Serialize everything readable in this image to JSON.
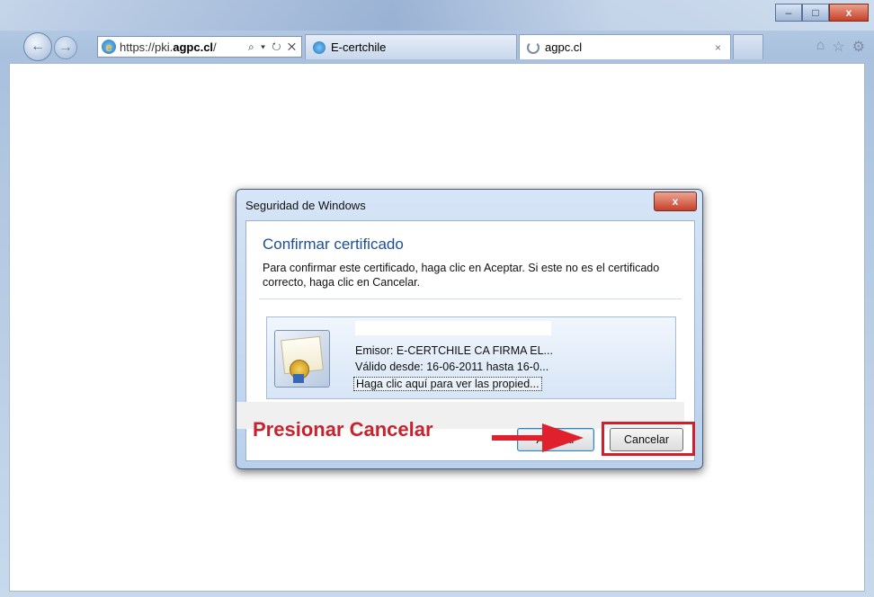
{
  "browser": {
    "address_url_prefix": "https://pki.",
    "address_url_domain": "agpc.cl",
    "address_url_suffix": "/",
    "address_tools": "⌕ ▾ ↻ ✕",
    "tabs": [
      {
        "label": "E-certchile",
        "close": ""
      },
      {
        "label": "agpc.cl",
        "close": "×"
      }
    ],
    "window_controls": {
      "minimize": "–",
      "maximize": "□",
      "close": "x"
    },
    "right_icons": {
      "home": "⌂",
      "favorites": "☆",
      "settings": "⚙"
    }
  },
  "dialog": {
    "title": "Seguridad de Windows",
    "close": "x",
    "heading": "Confirmar certificado",
    "message": "Para confirmar este certificado, haga clic en Aceptar. Si este no es el certificado correcto, haga clic en Cancelar.",
    "certificate": {
      "issuer": "Emisor: E-CERTCHILE CA FIRMA EL...",
      "valid": "Válido desde: 16-06-2011 hasta 16-0...",
      "properties_link": "Haga clic aquí para ver las propied..."
    },
    "ok_label": "Aceptar",
    "cancel_label": "Cancelar"
  },
  "annotation": {
    "callout": "Presionar Cancelar",
    "highlight_color": "#d0202c",
    "arrow_color": "#e0202c"
  }
}
